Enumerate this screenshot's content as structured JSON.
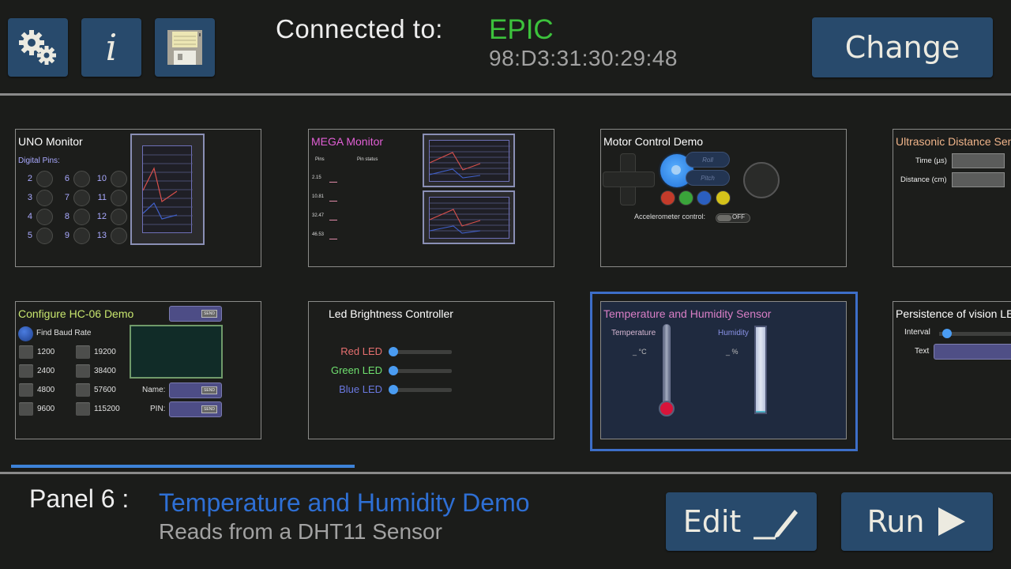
{
  "toolbar": {
    "settings_icon": "gears-icon",
    "info_label": "i",
    "save_icon": "floppy-disk-icon",
    "change_label": "Change"
  },
  "connection": {
    "label": "Connected to:",
    "device_name": "EPIC",
    "device_address": "98:D3:31:30:29:48",
    "name_color": "#3cc23c"
  },
  "panels": [
    {
      "title": "UNO Monitor",
      "title_color": "#ffffff",
      "subtitle": "Digital Pins:",
      "pins": [
        "2",
        "3",
        "4",
        "5",
        "6",
        "7",
        "8",
        "9",
        "10",
        "11",
        "12",
        "13"
      ]
    },
    {
      "title": "MEGA Monitor",
      "title_color": "#e25fd6",
      "col_headers": [
        "Pins",
        "Pin status"
      ],
      "values": [
        "2.15",
        "10.81",
        "32.47",
        "46.53"
      ]
    },
    {
      "title": "Motor Control Demo",
      "title_color": "#ffffff",
      "roll_label": "Roll",
      "pitch_label": "Pitch",
      "button_colors": [
        "#c33b2a",
        "#3aa43a",
        "#2b5fbf",
        "#d4c21a"
      ],
      "accel_label": "Accelerometer control:",
      "accel_state": "OFF"
    },
    {
      "title": "Ultrasonic Distance Sen",
      "title_color": "#f0b48a",
      "fields": [
        "Time (µs)",
        "Distance (cm)"
      ]
    },
    {
      "title": "Configure HC-06 Demo",
      "title_color": "#c8e66e",
      "find_label": "Find Baud Rate",
      "send_label": "SEND",
      "baud_rates": [
        "1200",
        "2400",
        "4800",
        "9600",
        "19200",
        "38400",
        "57600",
        "115200"
      ],
      "name_label": "Name:",
      "pin_label": "PIN:"
    },
    {
      "title": "Led Brightness Controller",
      "title_color": "#ffffff",
      "leds": [
        {
          "label": "Red LED",
          "color": "#e56f6f",
          "value": 0
        },
        {
          "label": "Green LED",
          "color": "#6fe06f",
          "value": 0
        },
        {
          "label": "Blue LED",
          "color": "#6a78e0",
          "value": 0
        }
      ]
    },
    {
      "title": "Temperature and Humidity Sensor",
      "title_color": "#d97fc6",
      "temp_label": "Temperature",
      "temp_value": "_ °C",
      "hum_label": "Humidity",
      "hum_value": "_ %",
      "selected": true
    },
    {
      "title": "Persistence of vision LE",
      "title_color": "#ffffff",
      "interval_label": "Interval",
      "text_label": "Text"
    }
  ],
  "footer": {
    "panel_number": "Panel 6 :",
    "panel_name": "Temperature and Humidity Demo",
    "panel_description": "Reads from a DHT11 Sensor",
    "edit_label": "Edit",
    "run_label": "Run"
  }
}
